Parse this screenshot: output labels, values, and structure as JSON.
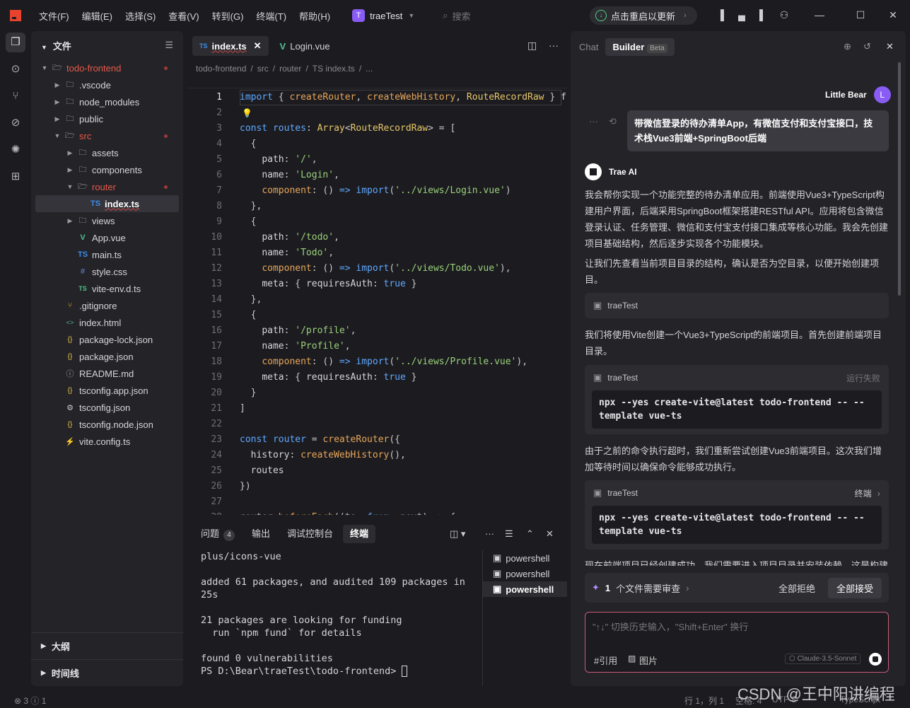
{
  "menu": [
    "文件(F)",
    "编辑(E)",
    "选择(S)",
    "查看(V)",
    "转到(G)",
    "终端(T)",
    "帮助(H)"
  ],
  "project": {
    "badge": "T",
    "name": "traeTest"
  },
  "search_placeholder": "搜索",
  "restart_label": "点击重启以更新",
  "explorer": {
    "title": "文件",
    "items": [
      {
        "label": "todo-frontend",
        "type": "folder-open",
        "depth": 0,
        "red": true,
        "dot": true
      },
      {
        "label": ".vscode",
        "type": "folder",
        "depth": 1
      },
      {
        "label": "node_modules",
        "type": "folder",
        "depth": 1
      },
      {
        "label": "public",
        "type": "folder",
        "depth": 1
      },
      {
        "label": "src",
        "type": "folder-open",
        "depth": 1,
        "red": true,
        "dot": true
      },
      {
        "label": "assets",
        "type": "folder",
        "depth": 2
      },
      {
        "label": "components",
        "type": "folder",
        "depth": 2
      },
      {
        "label": "router",
        "type": "folder-open",
        "depth": 2,
        "red": true,
        "dot": true
      },
      {
        "label": "index.ts",
        "type": "ts",
        "depth": 3,
        "selected": true
      },
      {
        "label": "views",
        "type": "folder",
        "depth": 2
      },
      {
        "label": "App.vue",
        "type": "vue",
        "depth": 2
      },
      {
        "label": "main.ts",
        "type": "ts",
        "depth": 2
      },
      {
        "label": "style.css",
        "type": "css",
        "depth": 2
      },
      {
        "label": "vite-env.d.ts",
        "type": "tsd",
        "depth": 2
      },
      {
        "label": ".gitignore",
        "type": "git",
        "depth": 1
      },
      {
        "label": "index.html",
        "type": "html",
        "depth": 1
      },
      {
        "label": "package-lock.json",
        "type": "json",
        "depth": 1
      },
      {
        "label": "package.json",
        "type": "json",
        "depth": 1
      },
      {
        "label": "README.md",
        "type": "md",
        "depth": 1
      },
      {
        "label": "tsconfig.app.json",
        "type": "json",
        "depth": 1
      },
      {
        "label": "tsconfig.json",
        "type": "cfg",
        "depth": 1
      },
      {
        "label": "tsconfig.node.json",
        "type": "json",
        "depth": 1
      },
      {
        "label": "vite.config.ts",
        "type": "vite",
        "depth": 1
      }
    ],
    "outline": "大纲",
    "timeline": "时间线"
  },
  "editor": {
    "tabs": [
      {
        "icon": "TS",
        "label": "index.ts",
        "active": true
      },
      {
        "icon": "V",
        "label": "Login.vue",
        "active": false
      }
    ],
    "breadcrumb": [
      "todo-frontend",
      "src",
      "router",
      "TS index.ts",
      "..."
    ],
    "code": [
      "import { createRouter, createWebHistory, RouteRecordRaw } f",
      "",
      "const routes: Array<RouteRecordRaw> = [",
      "  {",
      "    path: '/',",
      "    name: 'Login',",
      "    component: () => import('../views/Login.vue')",
      "  },",
      "  {",
      "    path: '/todo',",
      "    name: 'Todo',",
      "    component: () => import('../views/Todo.vue'),",
      "    meta: { requiresAuth: true }",
      "  },",
      "  {",
      "    path: '/profile',",
      "    name: 'Profile',",
      "    component: () => import('../views/Profile.vue'),",
      "    meta: { requiresAuth: true }",
      "  }",
      "]",
      "",
      "const router = createRouter({",
      "  history: createWebHistory(),",
      "  routes",
      "})",
      "",
      "router.beforeEach((to, from, next) => {"
    ]
  },
  "panel": {
    "tabs": [
      {
        "label": "问题",
        "badge": "4"
      },
      {
        "label": "输出"
      },
      {
        "label": "调试控制台"
      },
      {
        "label": "终端",
        "active": true
      }
    ],
    "terminal_lines": [
      "plus/icons-vue",
      "",
      "added 61 packages, and audited 109 packages in",
      "25s",
      "",
      "21 packages are looking for funding",
      "  run `npm fund` for details",
      "",
      "found 0 vulnerabilities",
      "PS D:\\Bear\\traeTest\\todo-frontend> "
    ],
    "terminals": [
      "powershell",
      "powershell",
      "powershell"
    ]
  },
  "chat": {
    "tabs": [
      "Chat",
      "Builder"
    ],
    "beta": "Beta",
    "user_name": "Little Bear",
    "user_avatar": "L",
    "user_message": "带微信登录的待办清单App，有微信支付和支付宝接口，技术栈Vue3前端+SpringBoot后端",
    "ai_name": "Trae AI",
    "p1": "我会帮你实现一个功能完整的待办清单应用。前端使用Vue3+TypeScript构建用户界面，后端采用SpringBoot框架搭建RESTful API。应用将包含微信登录认证、任务管理、微信和支付宝支付接口集成等核心功能。我会先创建项目基础结构，然后逐步实现各个功能模块。",
    "p2": "让我们先查看当前项目目录的结构，确认是否为空目录，以便开始创建项目。",
    "folder_card": "traeTest",
    "p3": "我们将使用Vite创建一个Vue3+TypeScript的前端项目。首先创建前端项目目录。",
    "cmd1": {
      "title": "traeTest",
      "status": "运行失败",
      "command": "npx --yes create-vite@latest todo-frontend -- --template vue-ts"
    },
    "p4": "由于之前的命令执行超时，我们重新尝试创建Vue3前端项目。这次我们增加等待时间以确保命令能够成功执行。",
    "cmd2": {
      "title": "traeTest",
      "status": "终端",
      "command": "npx --yes create-vite@latest todo-frontend -- --template vue-ts"
    },
    "p5": "现在前端项目已经创建成功，我们需要进入项目目录并安装依赖，这是构建",
    "review": {
      "count": "1",
      "label": "个文件需要审查",
      "reject": "全部拒绝",
      "accept": "全部接受"
    },
    "input_placeholder": "\"↑↓\" 切换历史输入，\"Shift+Enter\" 换行",
    "ref_label": "#引用",
    "image_label": "图片",
    "model": "Claude-3.5-Sonnet"
  },
  "status": {
    "errors": "3",
    "warnings": "1",
    "position": "行 1，列 1",
    "indent": "空格: 4",
    "encoding": "UTF-8",
    "lang": "TypeScript"
  },
  "watermark": "CSDN @王中阳讲编程"
}
